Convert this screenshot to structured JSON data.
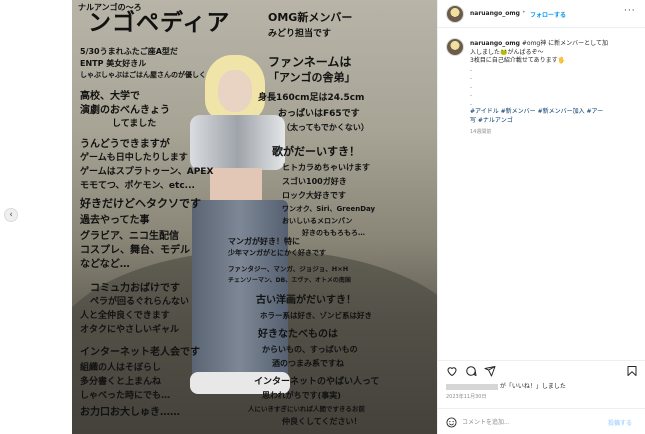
{
  "header": {
    "username": "naruango_omg",
    "follow_label": "フォローする",
    "more_label": "···"
  },
  "caption": {
    "username": "naruango_omg",
    "lines": [
      "#omg神 に新メンバーとして加",
      "入しました🐸がんばるぞ〜",
      "3枚目に自己紹介載せてあります🖐",
      ".",
      ".",
      ".",
      ".",
      "."
    ],
    "hashtags_line1": "#アイドル #新メンバー #新メンバー加入 #アー",
    "hashtags_line2": "写 #ナルアンゴ",
    "time_ago": "14週間前"
  },
  "engagement": {
    "likes_suffix": "が「いいね！」しました",
    "date": "2023年11月30日"
  },
  "comment": {
    "placeholder": "コメントを追加...",
    "post_label": "投稿する"
  },
  "nav": {
    "prev_label": "‹"
  },
  "overlay": {
    "title_small": "ナルアンゴの〜ろ",
    "title_big": "ンゴペディア",
    "header_right": "OMG新メンバー",
    "header_right2": "みどり担当です",
    "lines": [
      "5/30うまれふたご座A型だ",
      "ENTP 美女好きル",
      "しゃぶしゃぶはごはん屋さんのが優しく",
      "高校、大学で",
      "演劇のおべんきょう",
      "してました",
      "うんどうできますが",
      "ゲームも日中したりします",
      "ゲームはスプラトゥーン、APEX",
      "モモてつ、ポケモン、etc...",
      "好きだけどヘタクソです",
      "過去やってた事",
      "グラビア、ニコ生配信",
      "コスプレ、舞台、モデル",
      "などなど…",
      "コミュ力おばけです",
      "ペラが回るぐれらんない",
      "人と全仲良くできます",
      "オタクにやさしいギャル",
      "インターネット老人会です",
      "組織の人はそぼらし",
      "多分書くと上まんね",
      "しゃべった時にでも…",
      "お力口お大しゅき……"
    ],
    "right_lines": [
      "ファンネームは",
      "「アンゴの舎弟」",
      "身長160cm足は24.5cm",
      "おっぱいはF65です",
      "（太ってもでかくない）",
      "歌がだーいすき！",
      "ヒトカラめちゃいけます",
      "スゴい100ガ好き",
      "ロック大好きです",
      "ワンオク、Siri、GreenDay",
      "おいしいるメロンパン",
      "好きのももろもろ…",
      "マンガが好き！特に",
      "少年マンガがとにかく好きです",
      "ファンタジー、マンガ、ジョジョ、H×H",
      "チェンソーマン、DB、エヴァ、オトメの南国",
      "古い洋画がだいすき！",
      "ホラー系は好き、ゾンビ系は好き",
      "好きなたべものは",
      "からいもの、すっぱいもの",
      "酒のつまみ系ですね",
      "インターネットのやばい人って",
      "思われがちです(事実)",
      "人にいきすぎにいれば人間ですきるお前",
      "仲良くしてください！"
    ]
  },
  "colors": {
    "accent_blue": "#0095f6",
    "hashtag": "#00376b",
    "muted": "#8e8e8e",
    "border": "#efefef"
  }
}
